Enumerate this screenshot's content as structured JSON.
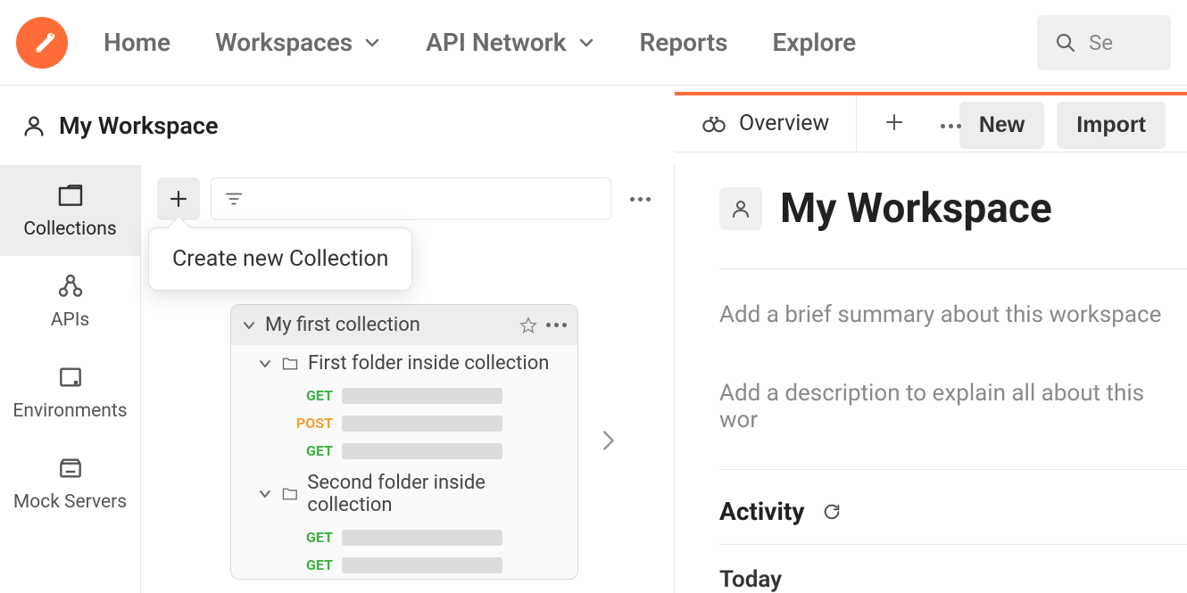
{
  "nav": {
    "home": "Home",
    "workspaces": "Workspaces",
    "api_network": "API Network",
    "reports": "Reports",
    "explore": "Explore",
    "search_hint": "Se"
  },
  "workspace_header": {
    "title": "My Workspace",
    "new_btn": "New",
    "import_btn": "Import"
  },
  "left_rail": {
    "collections": "Collections",
    "apis": "APIs",
    "environments": "Environments",
    "mock_servers": "Mock Servers"
  },
  "tooltip": "Create new Collection",
  "sample_card": {
    "title": "My first collection",
    "folder1": "First folder inside collection",
    "folder2": "Second folder inside collection",
    "methods": {
      "get": "GET",
      "post": "POST"
    }
  },
  "overview": {
    "tab_label": "Overview",
    "big_title": "My Workspace",
    "summary_placeholder": "Add a brief summary about this workspace",
    "description_placeholder": "Add a description to explain all about this wor",
    "activity_label": "Activity",
    "today_label": "Today"
  }
}
